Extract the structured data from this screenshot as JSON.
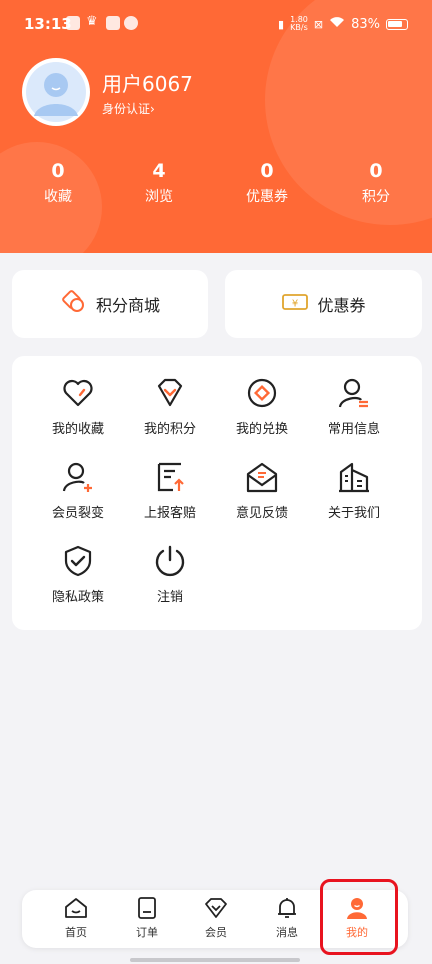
{
  "status_bar": {
    "time": "13:13",
    "network_speed_value": "1.80",
    "network_speed_unit": "KB/s",
    "battery": "83%"
  },
  "profile": {
    "username": "用户6067",
    "verify_label": "身份认证",
    "chevron": "›"
  },
  "stats": [
    {
      "value": "0",
      "label": "收藏"
    },
    {
      "value": "4",
      "label": "浏览"
    },
    {
      "value": "0",
      "label": "优惠券"
    },
    {
      "value": "0",
      "label": "积分"
    }
  ],
  "quick_cards": [
    {
      "label": "积分商城",
      "icon": "points-coin-icon"
    },
    {
      "label": "优惠券",
      "icon": "coupon-ticket-icon"
    }
  ],
  "menu": [
    {
      "label": "我的收藏",
      "icon": "heart-icon"
    },
    {
      "label": "我的积分",
      "icon": "diamond-icon"
    },
    {
      "label": "我的兑换",
      "icon": "exchange-icon"
    },
    {
      "label": "常用信息",
      "icon": "user-info-icon"
    },
    {
      "label": "会员裂变",
      "icon": "add-user-icon"
    },
    {
      "label": "上报客赔",
      "icon": "report-icon"
    },
    {
      "label": "意见反馈",
      "icon": "feedback-mail-icon"
    },
    {
      "label": "关于我们",
      "icon": "building-icon"
    },
    {
      "label": "隐私政策",
      "icon": "shield-check-icon"
    },
    {
      "label": "注销",
      "icon": "power-icon"
    }
  ],
  "tabbar": [
    {
      "label": "首页",
      "icon": "home-icon",
      "active": false
    },
    {
      "label": "订单",
      "icon": "order-icon",
      "active": false
    },
    {
      "label": "会员",
      "icon": "member-diamond-icon",
      "active": false
    },
    {
      "label": "消息",
      "icon": "bell-icon",
      "active": false
    },
    {
      "label": "我的",
      "icon": "person-icon",
      "active": true
    }
  ],
  "colors": {
    "primary": "#ff6936",
    "background": "#f3f3f6",
    "card": "#ffffff",
    "highlight": "#e8131f"
  }
}
